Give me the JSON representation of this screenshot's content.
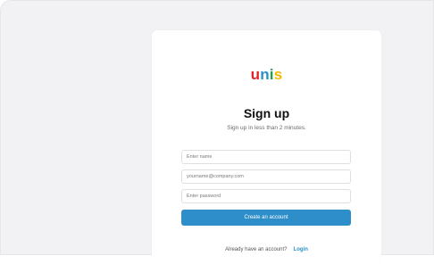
{
  "logo": {
    "letters": [
      "u",
      "n",
      "i",
      "s"
    ],
    "colors": [
      "#e3232b",
      "#2d8ec9",
      "#1aa34a",
      "#f5b800"
    ]
  },
  "header": {
    "title": "Sign up",
    "subtitle": "Sign up in less than 2 minutes."
  },
  "form": {
    "name_placeholder": "Enter name",
    "email_placeholder": "yourname@company.com",
    "password_placeholder": "Enter password",
    "submit_label": "Create an account"
  },
  "footer": {
    "prompt": "Already have an account?",
    "login_label": "Login"
  }
}
